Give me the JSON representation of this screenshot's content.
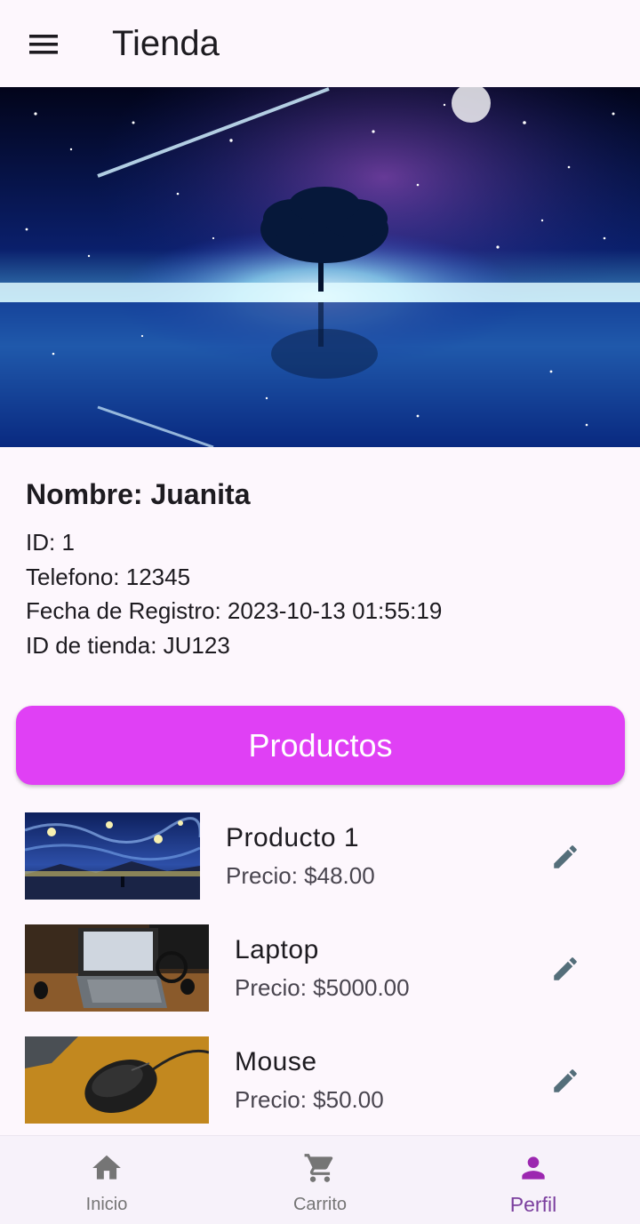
{
  "appbar": {
    "title": "Tienda",
    "menu_icon": "menu-icon"
  },
  "banner": {
    "description_icon": "starry-night-tree-image"
  },
  "profile": {
    "name": "Nombre: Juanita",
    "lines": [
      "ID: 1",
      "Telefono: 12345",
      "Fecha de Registro: 2023-10-13 01:55:19",
      "ID de tienda: JU123"
    ]
  },
  "productos_button": {
    "label": "Productos",
    "color": "#e040f5"
  },
  "products": [
    {
      "name": "Producto 1",
      "price": "Precio: $48.00",
      "image": "starry-landscape-thumbnail",
      "edit_icon": "edit-icon"
    },
    {
      "name": "Laptop",
      "price": "Precio: $5000.00",
      "image": "laptop-photo-thumbnail",
      "edit_icon": "edit-icon"
    },
    {
      "name": "Mouse",
      "price": "Precio: $50.00",
      "image": "mouse-photo-thumbnail",
      "edit_icon": "edit-icon"
    }
  ],
  "bottom_nav": {
    "items": [
      {
        "label": "Inicio",
        "icon": "home-icon",
        "active": false
      },
      {
        "label": "Carrito",
        "icon": "cart-icon",
        "active": false
      },
      {
        "label": "Perfil",
        "icon": "person-icon",
        "active": true
      }
    ],
    "active_color": "#7b3f9e",
    "inactive_color": "#757575"
  }
}
